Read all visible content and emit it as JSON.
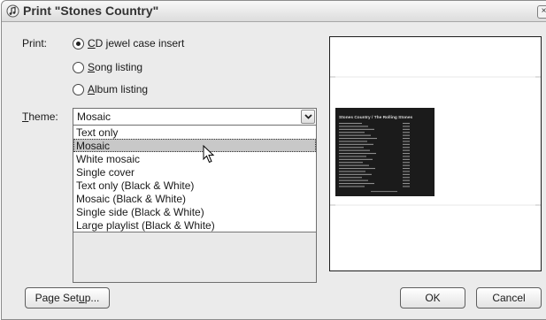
{
  "window": {
    "title_prefix": "Print ",
    "title_name": "\"Stones Country\"",
    "close_glyph": "×"
  },
  "print_section": {
    "label": "Print:",
    "options": [
      {
        "pre": "",
        "key": "C",
        "rest": "D jewel case insert",
        "checked": true
      },
      {
        "pre": "",
        "key": "S",
        "rest": "ong listing",
        "checked": false
      },
      {
        "pre": "",
        "key": "A",
        "rest": "lbum listing",
        "checked": false
      }
    ]
  },
  "theme": {
    "label_key": "T",
    "label_rest": "heme:",
    "selected": "Mosaic",
    "options": [
      "Text only",
      "Mosaic",
      "White mosaic",
      "Single cover",
      "Text only (Black & White)",
      "Mosaic (Black & White)",
      "Single side (Black & White)",
      "Large playlist (Black & White)"
    ],
    "highlighted_index": 1
  },
  "preview": {
    "header": "Stones Country / The Rolling Stones"
  },
  "buttons": {
    "page_setup_pre": "Page Set",
    "page_setup_key": "u",
    "page_setup_post": "p...",
    "ok": "OK",
    "cancel": "Cancel"
  },
  "colors": {
    "dialog_bg": "#ebebeb",
    "highlight": "#c8c8c8",
    "preview_panel": "#1b1b1b",
    "preview_text": "#d0d0d0"
  }
}
